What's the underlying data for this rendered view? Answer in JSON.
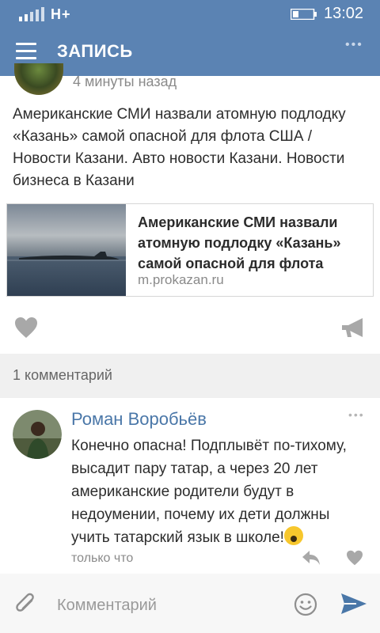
{
  "status_bar": {
    "network": "H+",
    "time": "13:02"
  },
  "header": {
    "title": "ЗАПИСЬ",
    "menu_icon": "hamburger-icon",
    "more_icon": "more-dots-icon",
    "bg_color": "#5b83b3"
  },
  "post": {
    "time": "4 минуты назад",
    "text": "Американские СМИ назвали атомную подлодку «Казань» самой опасной для флота США / Новости Казани. Авто новости Казани. Новости бизнеса в Казани",
    "link": {
      "title": "Американские СМИ назвали атомную подлодку «Казань» самой опасной для флота",
      "domain": "m.prokazan.ru"
    },
    "actions": {
      "like_icon": "heart-icon",
      "share_icon": "megaphone-icon"
    }
  },
  "comments": {
    "count_label": "1 комментарий",
    "items": [
      {
        "author": "Роман Воробьёв",
        "text": "Конечно опасна! Подплывёт по-тихому, высадит пару татар, а через 20 лет американские родители будут в недоумении, почему их дети должны учить татарский язык в школе!",
        "emoji": "screaming-face-emoji",
        "time": "только что"
      }
    ]
  },
  "composer": {
    "placeholder": "Комментарий"
  },
  "colors": {
    "accent": "#4a77a8",
    "muted_text": "#8a8a8a",
    "band": "#f0f0f0"
  }
}
